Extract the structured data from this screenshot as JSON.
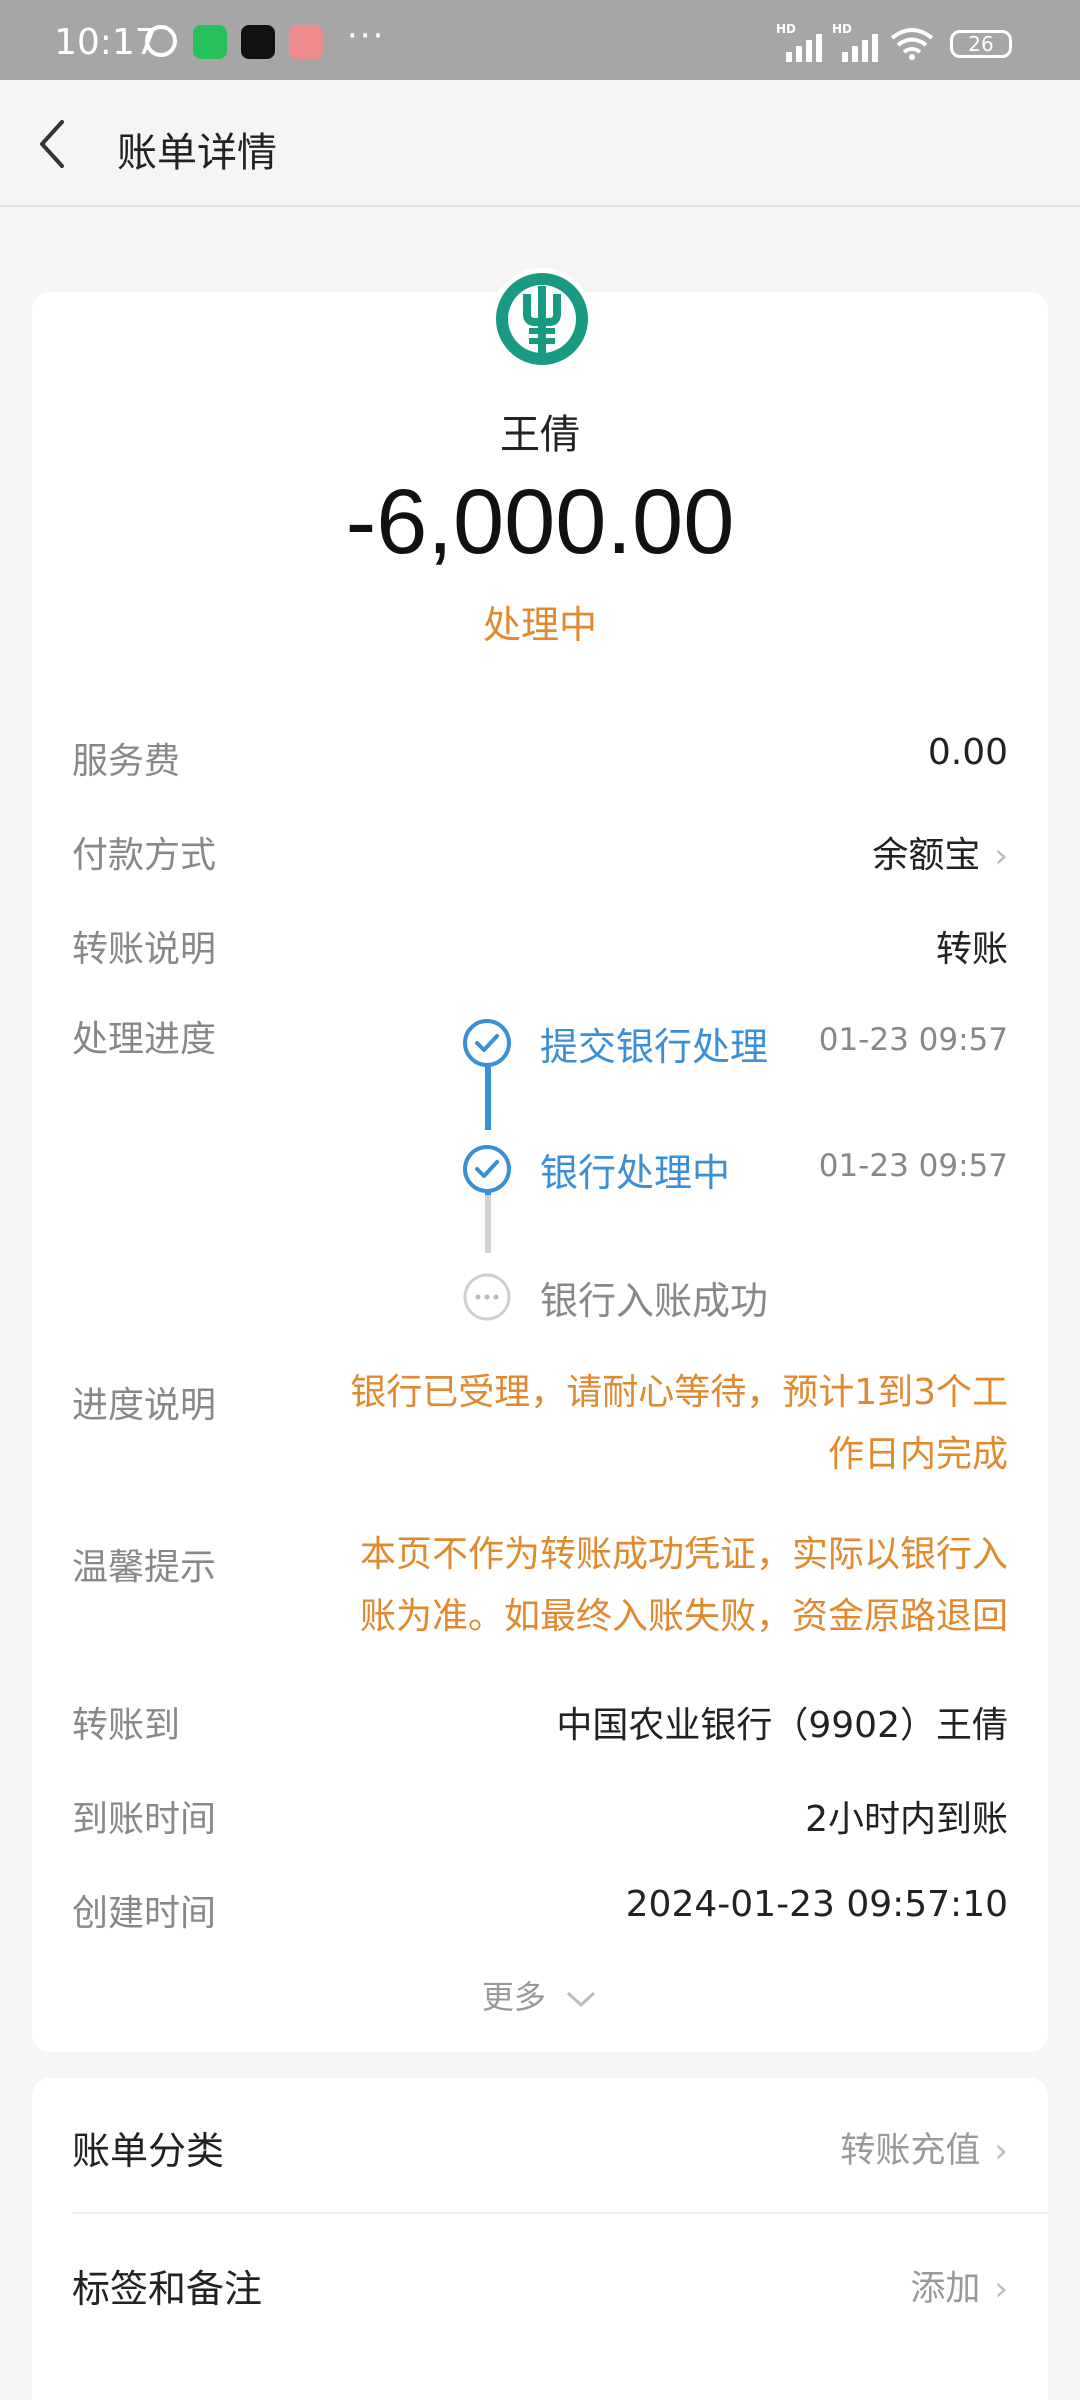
{
  "status_bar": {
    "time": "10:17",
    "hd1": "HD",
    "hd2": "HD",
    "battery": "26",
    "more": "···"
  },
  "header": {
    "title": "账单详情"
  },
  "summary": {
    "bank_icon": "abc-bank-logo",
    "payee": "王倩",
    "amount": "-6,000.00",
    "status": "处理中"
  },
  "details": {
    "service_fee_label": "服务费",
    "service_fee_value": "0.00",
    "payment_method_label": "付款方式",
    "payment_method_value": "余额宝",
    "transfer_note_label": "转账说明",
    "transfer_note_value": "转账",
    "progress_label": "处理进度",
    "progress_steps": [
      {
        "label": "提交银行处理",
        "time": "01-23 09:57",
        "state": "done"
      },
      {
        "label": "银行处理中",
        "time": "01-23 09:57",
        "state": "done"
      },
      {
        "label": "银行入账成功",
        "time": "",
        "state": "pending"
      }
    ],
    "progress_desc_label": "进度说明",
    "progress_desc_line1": "银行已受理，请耐心等待，预计1到3个工",
    "progress_desc_line2": "作日内完成",
    "tip_label": "温馨提示",
    "tip_line1": "本页不作为转账成功凭证，实际以银行入",
    "tip_line2": "账为准。如最终入账失败，资金原路退回",
    "to_label": "转账到",
    "to_value": "中国农业银行（9902）王倩",
    "arrival_label": "到账时间",
    "arrival_value": "2小时内到账",
    "created_label": "创建时间",
    "created_value": "2024-01-23 09:57:10",
    "more_label": "更多"
  },
  "category": {
    "category_label": "账单分类",
    "category_value": "转账充值",
    "tags_label": "标签和备注",
    "tags_value": "添加"
  },
  "colors": {
    "accent_orange": "#e0892f",
    "accent_blue": "#3a8fd6",
    "bank_green": "#1a9a83"
  }
}
